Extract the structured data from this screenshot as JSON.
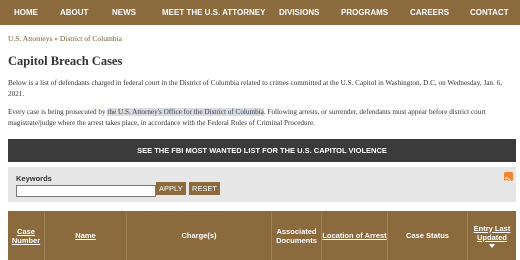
{
  "nav": {
    "items": [
      "HOME",
      "ABOUT",
      "NEWS",
      "MEET THE U.S. ATTORNEY",
      "DIVISIONS",
      "PROGRAMS",
      "CAREERS",
      "CONTACT"
    ]
  },
  "breadcrumb": {
    "home": "U.S. Attorneys",
    "separator": "»",
    "current": "District of Columbia"
  },
  "page": {
    "title": "Capitol Breach Cases"
  },
  "intro": {
    "p1": "Below is a list of defendants charged in federal court in the District of Columbia related to crimes committed at the U.S. Capitol in Washington, D.C, on Wednesday, Jan. 6, 2021.",
    "p2_before": "Every case is being prosecuted by ",
    "p2_link": "the U.S. Attorney's Office for the District of Columbia",
    "p2_after": ". Following arrests, or surrender, defendants must appear before district court magistrate/judge where the arrest takes place, in accordance with the Federal Rules of Criminal Procedure."
  },
  "banner": {
    "text": "SEE THE FBI MOST WANTED LIST FOR THE U.S. CAPITOL VIOLENCE"
  },
  "search": {
    "label": "Keywords",
    "value": "",
    "apply_label": "APPLY",
    "reset_label": "RESET",
    "rss_icon": "rss-icon"
  },
  "table": {
    "headers": [
      {
        "label": "Case Number",
        "sortable": true
      },
      {
        "label": "Name",
        "sortable": true
      },
      {
        "label": "Charge(s)",
        "sortable": false
      },
      {
        "label": "Associated Documents",
        "sortable": false
      },
      {
        "label": "Location of Arrest",
        "sortable": true
      },
      {
        "label": "Case Status",
        "sortable": false
      },
      {
        "label": "Entry Last Updated",
        "sortable": true,
        "sorted": "descending"
      }
    ]
  },
  "colors": {
    "brand": "#8b6a3e",
    "banner": "#3b3b3b",
    "panel": "#e6e6e6",
    "rss": "#f0852f"
  }
}
